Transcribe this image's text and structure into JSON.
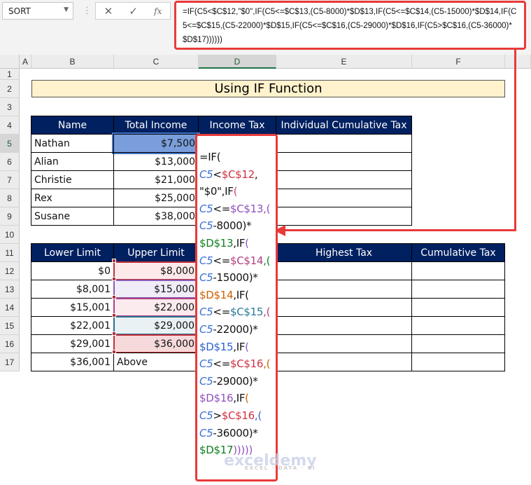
{
  "name_box": "SORT",
  "formula_bar": {
    "fx_label": "fx",
    "cancel_icon": "✕",
    "enter_icon": "✓",
    "formula": "=IF(C5<$C$12,\"$0\",IF(C5<=$C$13,(C5-8000)*$D$13,IF(C5<=$C$14,(C5-15000)*$D$14,IF(C5<=$C$15,(C5-22000)*$D$15,IF(C5<=$C$16,(C5-29000)*$D$16,IF(C5>$C$16,(C5-36000)*$D$17))))))"
  },
  "columns": [
    "A",
    "B",
    "C",
    "D",
    "E",
    "F"
  ],
  "rows": [
    "1",
    "2",
    "3",
    "4",
    "5",
    "6",
    "7",
    "8",
    "9",
    "10",
    "11",
    "12",
    "13",
    "14",
    "15",
    "16",
    "17"
  ],
  "title": "Using IF Function",
  "table1": {
    "headers": [
      "Name",
      "Total Income",
      "Income Tax",
      "Individual Cumulative Tax"
    ],
    "rows": [
      [
        "Nathan",
        "$7,500"
      ],
      [
        "Alian",
        "$13,000"
      ],
      [
        "Christie",
        "$21,000"
      ],
      [
        "Rex",
        "$25,000"
      ],
      [
        "Susane",
        "$38,000"
      ]
    ]
  },
  "table2": {
    "headers": [
      "Lower Limit",
      "Upper Limit",
      "",
      "Highest Tax",
      "Cumulative Tax"
    ],
    "rows": [
      [
        "$0",
        "$8,000"
      ],
      [
        "$8,001",
        "$15,000"
      ],
      [
        "$15,001",
        "$22,000"
      ],
      [
        "$22,001",
        "$29,000"
      ],
      [
        "$29,001",
        "$36,000"
      ],
      [
        "$36,001",
        "Above"
      ]
    ]
  },
  "colors": {
    "header_bg": "#002060",
    "title_bg": "#fff2cc",
    "callout": "#e83a3a"
  },
  "tooltip_lines": [
    [
      [
        "=IF(",
        "#111"
      ]
    ],
    [
      [
        "C5",
        "#3a6fd8"
      ],
      [
        "<",
        "#111"
      ],
      [
        "$C$12",
        "#d03040"
      ],
      [
        ",",
        "#111"
      ]
    ],
    [
      [
        "\"$0\",IF",
        "#111"
      ],
      [
        "(",
        "#d04080"
      ]
    ],
    [
      [
        "C5",
        "#3a6fd8"
      ],
      [
        "<=",
        "#111"
      ],
      [
        "$C$13",
        "#9050c0"
      ],
      [
        ",(",
        "#9050c0"
      ]
    ],
    [
      [
        "C5",
        "#3a6fd8"
      ],
      [
        "-8000)*",
        "#111"
      ]
    ],
    [
      [
        "$D$13",
        "#108020"
      ],
      [
        ",IF",
        "#111"
      ],
      [
        "(",
        "#9050c0"
      ]
    ],
    [
      [
        "C5",
        "#3a6fd8"
      ],
      [
        "<=",
        "#111"
      ],
      [
        "$C$14",
        "#b04080"
      ],
      [
        ",(",
        "#108020"
      ]
    ],
    [
      [
        "C5",
        "#3a6fd8"
      ],
      [
        "-15000)*",
        "#111"
      ]
    ],
    [
      [
        "$D$14",
        "#d06000"
      ],
      [
        ",IF(",
        "#111"
      ]
    ],
    [
      [
        "C5",
        "#3a6fd8"
      ],
      [
        "<=",
        "#111"
      ],
      [
        "$C$15",
        "#2a7a9a"
      ],
      [
        ",(",
        "#b04080"
      ]
    ],
    [
      [
        "C5",
        "#3a6fd8"
      ],
      [
        "-22000)*",
        "#111"
      ]
    ],
    [
      [
        "$D$15",
        "#3060d0"
      ],
      [
        ",IF",
        "#111"
      ],
      [
        "(",
        "#9050c0"
      ]
    ],
    [
      [
        "C5",
        "#3a6fd8"
      ],
      [
        "<=",
        "#111"
      ],
      [
        "$C$16",
        "#d03040"
      ],
      [
        ",(",
        "#d06000"
      ]
    ],
    [
      [
        "C5",
        "#3a6fd8"
      ],
      [
        "-29000)*",
        "#111"
      ]
    ],
    [
      [
        "$D$16",
        "#9050c0"
      ],
      [
        ",IF",
        "#111"
      ],
      [
        "(",
        "#d06000"
      ]
    ],
    [
      [
        "C5",
        "#3a6fd8"
      ],
      [
        ">",
        "#111"
      ],
      [
        "$C$16",
        "#d03040"
      ],
      [
        ",(",
        "#3060d0"
      ]
    ],
    [
      [
        "C5",
        "#3a6fd8"
      ],
      [
        "-36000)*",
        "#111"
      ]
    ],
    [
      [
        "$D$17",
        "#108020"
      ],
      [
        ")))))",
        "#9050c0"
      ]
    ]
  ],
  "watermark": {
    "brand": "exceldemy",
    "tagline": "EXCEL · DATA · BI"
  }
}
